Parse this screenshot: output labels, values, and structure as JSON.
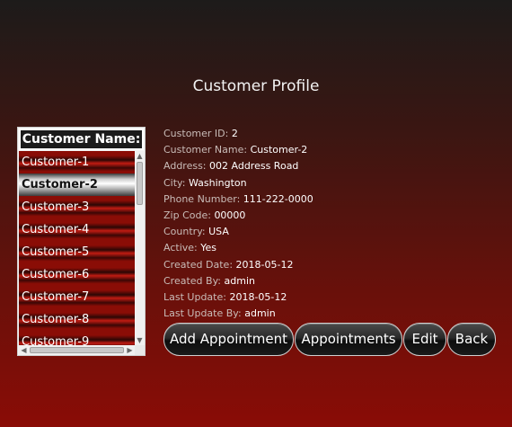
{
  "page": {
    "title": "Customer Profile"
  },
  "customer_list": {
    "header": "Customer Name:",
    "items": [
      "Customer-1",
      "Customer-2",
      "Customer-3",
      "Customer-4",
      "Customer-5",
      "Customer-6",
      "Customer-7",
      "Customer-8",
      "Customer-9"
    ],
    "selected_index": 1
  },
  "details": [
    {
      "label": "Customer ID:",
      "value": "2"
    },
    {
      "label": "Customer Name:",
      "value": "Customer-2"
    },
    {
      "label": "Address:",
      "value": "002 Address Road"
    },
    {
      "label": "City:",
      "value": "Washington"
    },
    {
      "label": "Phone Number:",
      "value": "111-222-0000"
    },
    {
      "label": "Zip Code:",
      "value": "00000"
    },
    {
      "label": "Country:",
      "value": "USA"
    },
    {
      "label": "Active:",
      "value": "Yes"
    },
    {
      "label": "Created Date:",
      "value": "2018-05-12"
    },
    {
      "label": "Created By:",
      "value": "admin"
    },
    {
      "label": "Last Update:",
      "value": "2018-05-12"
    },
    {
      "label": "Last Update By:",
      "value": "admin"
    }
  ],
  "buttons": {
    "add_appointment": "Add Appointment",
    "appointments": "Appointments",
    "edit": "Edit",
    "back": "Back"
  },
  "icons": {
    "scroll_up": "arrow-up-icon",
    "scroll_down": "arrow-down-icon",
    "scroll_left": "arrow-left-icon",
    "scroll_right": "arrow-right-icon"
  },
  "colors": {
    "background_top": "#1d1b1a",
    "background_bottom": "#8a0c06",
    "list_item_red": "#8a0d06"
  }
}
